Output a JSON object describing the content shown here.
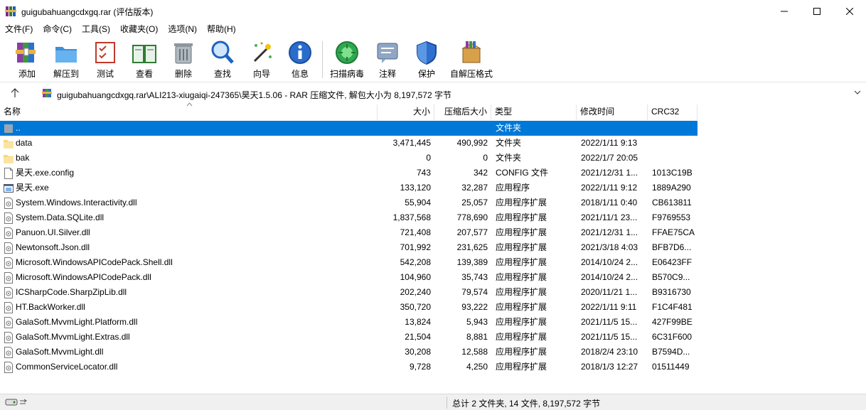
{
  "window": {
    "title": "guigubahuangcdxgq.rar (评估版本)"
  },
  "menu": [
    "文件(F)",
    "命令(C)",
    "工具(S)",
    "收藏夹(O)",
    "选项(N)",
    "帮助(H)"
  ],
  "toolbar": [
    {
      "label": "添加",
      "icon": "add-archive-icon"
    },
    {
      "label": "解压到",
      "icon": "extract-to-icon"
    },
    {
      "label": "测试",
      "icon": "test-icon"
    },
    {
      "label": "查看",
      "icon": "view-book-icon"
    },
    {
      "label": "删除",
      "icon": "trash-icon"
    },
    {
      "label": "查找",
      "icon": "magnifier-icon"
    },
    {
      "label": "向导",
      "icon": "wizard-wand-icon"
    },
    {
      "label": "信息",
      "icon": "info-icon"
    },
    {
      "label": "扫描病毒",
      "icon": "virus-scan-icon"
    },
    {
      "label": "注释",
      "icon": "comment-icon"
    },
    {
      "label": "保护",
      "icon": "shield-icon"
    },
    {
      "label": "自解压格式",
      "icon": "sfx-box-icon"
    }
  ],
  "address": {
    "path": "guigubahuangcdxgq.rar\\ALI213-xiugaiqi-247365\\昊天1.5.06 - RAR 压缩文件, 解包大小为 8,197,572 字节"
  },
  "columns": [
    "名称",
    "大小",
    "压缩后大小",
    "类型",
    "修改时间",
    "CRC32"
  ],
  "files": [
    {
      "name": "..",
      "size": "",
      "packed": "",
      "type": "文件夹",
      "modified": "",
      "crc": "",
      "kind": "up"
    },
    {
      "name": "data",
      "size": "3,471,445",
      "packed": "490,992",
      "type": "文件夹",
      "modified": "2022/1/11 9:13",
      "crc": "",
      "kind": "folder"
    },
    {
      "name": "bak",
      "size": "0",
      "packed": "0",
      "type": "文件夹",
      "modified": "2022/1/7 20:05",
      "crc": "",
      "kind": "folder"
    },
    {
      "name": "昊天.exe.config",
      "size": "743",
      "packed": "342",
      "type": "CONFIG 文件",
      "modified": "2021/12/31 1...",
      "crc": "1013C19B",
      "kind": "file"
    },
    {
      "name": "昊天.exe",
      "size": "133,120",
      "packed": "32,287",
      "type": "应用程序",
      "modified": "2022/1/11 9:12",
      "crc": "1889A290",
      "kind": "exe"
    },
    {
      "name": "System.Windows.Interactivity.dll",
      "size": "55,904",
      "packed": "25,057",
      "type": "应用程序扩展",
      "modified": "2018/1/11 0:40",
      "crc": "CB613811",
      "kind": "dll"
    },
    {
      "name": "System.Data.SQLite.dll",
      "size": "1,837,568",
      "packed": "778,690",
      "type": "应用程序扩展",
      "modified": "2021/11/1 23...",
      "crc": "F9769553",
      "kind": "dll"
    },
    {
      "name": "Panuon.UI.Silver.dll",
      "size": "721,408",
      "packed": "207,577",
      "type": "应用程序扩展",
      "modified": "2021/12/31 1...",
      "crc": "FFAE75CA",
      "kind": "dll"
    },
    {
      "name": "Newtonsoft.Json.dll",
      "size": "701,992",
      "packed": "231,625",
      "type": "应用程序扩展",
      "modified": "2021/3/18 4:03",
      "crc": "BFB7D6...",
      "kind": "dll"
    },
    {
      "name": "Microsoft.WindowsAPICodePack.Shell.dll",
      "size": "542,208",
      "packed": "139,389",
      "type": "应用程序扩展",
      "modified": "2014/10/24 2...",
      "crc": "E06423FF",
      "kind": "dll"
    },
    {
      "name": "Microsoft.WindowsAPICodePack.dll",
      "size": "104,960",
      "packed": "35,743",
      "type": "应用程序扩展",
      "modified": "2014/10/24 2...",
      "crc": "B570C9...",
      "kind": "dll"
    },
    {
      "name": "ICSharpCode.SharpZipLib.dll",
      "size": "202,240",
      "packed": "79,574",
      "type": "应用程序扩展",
      "modified": "2020/11/21 1...",
      "crc": "B9316730",
      "kind": "dll"
    },
    {
      "name": "HT.BackWorker.dll",
      "size": "350,720",
      "packed": "93,222",
      "type": "应用程序扩展",
      "modified": "2022/1/11 9:11",
      "crc": "F1C4F481",
      "kind": "dll"
    },
    {
      "name": "GalaSoft.MvvmLight.Platform.dll",
      "size": "13,824",
      "packed": "5,943",
      "type": "应用程序扩展",
      "modified": "2021/11/5 15...",
      "crc": "427F99BE",
      "kind": "dll"
    },
    {
      "name": "GalaSoft.MvvmLight.Extras.dll",
      "size": "21,504",
      "packed": "8,881",
      "type": "应用程序扩展",
      "modified": "2021/11/5 15...",
      "crc": "6C31F600",
      "kind": "dll"
    },
    {
      "name": "GalaSoft.MvvmLight.dll",
      "size": "30,208",
      "packed": "12,588",
      "type": "应用程序扩展",
      "modified": "2018/2/4 23:10",
      "crc": "B7594D...",
      "kind": "dll"
    },
    {
      "name": "CommonServiceLocator.dll",
      "size": "9,728",
      "packed": "4,250",
      "type": "应用程序扩展",
      "modified": "2018/1/3 12:27",
      "crc": "01511449",
      "kind": "dll"
    }
  ],
  "status": {
    "summary": "总计 2 文件夹, 14 文件, 8,197,572 字节"
  },
  "colors": {
    "selection": "#0078d7",
    "folder": "#f8d775"
  }
}
